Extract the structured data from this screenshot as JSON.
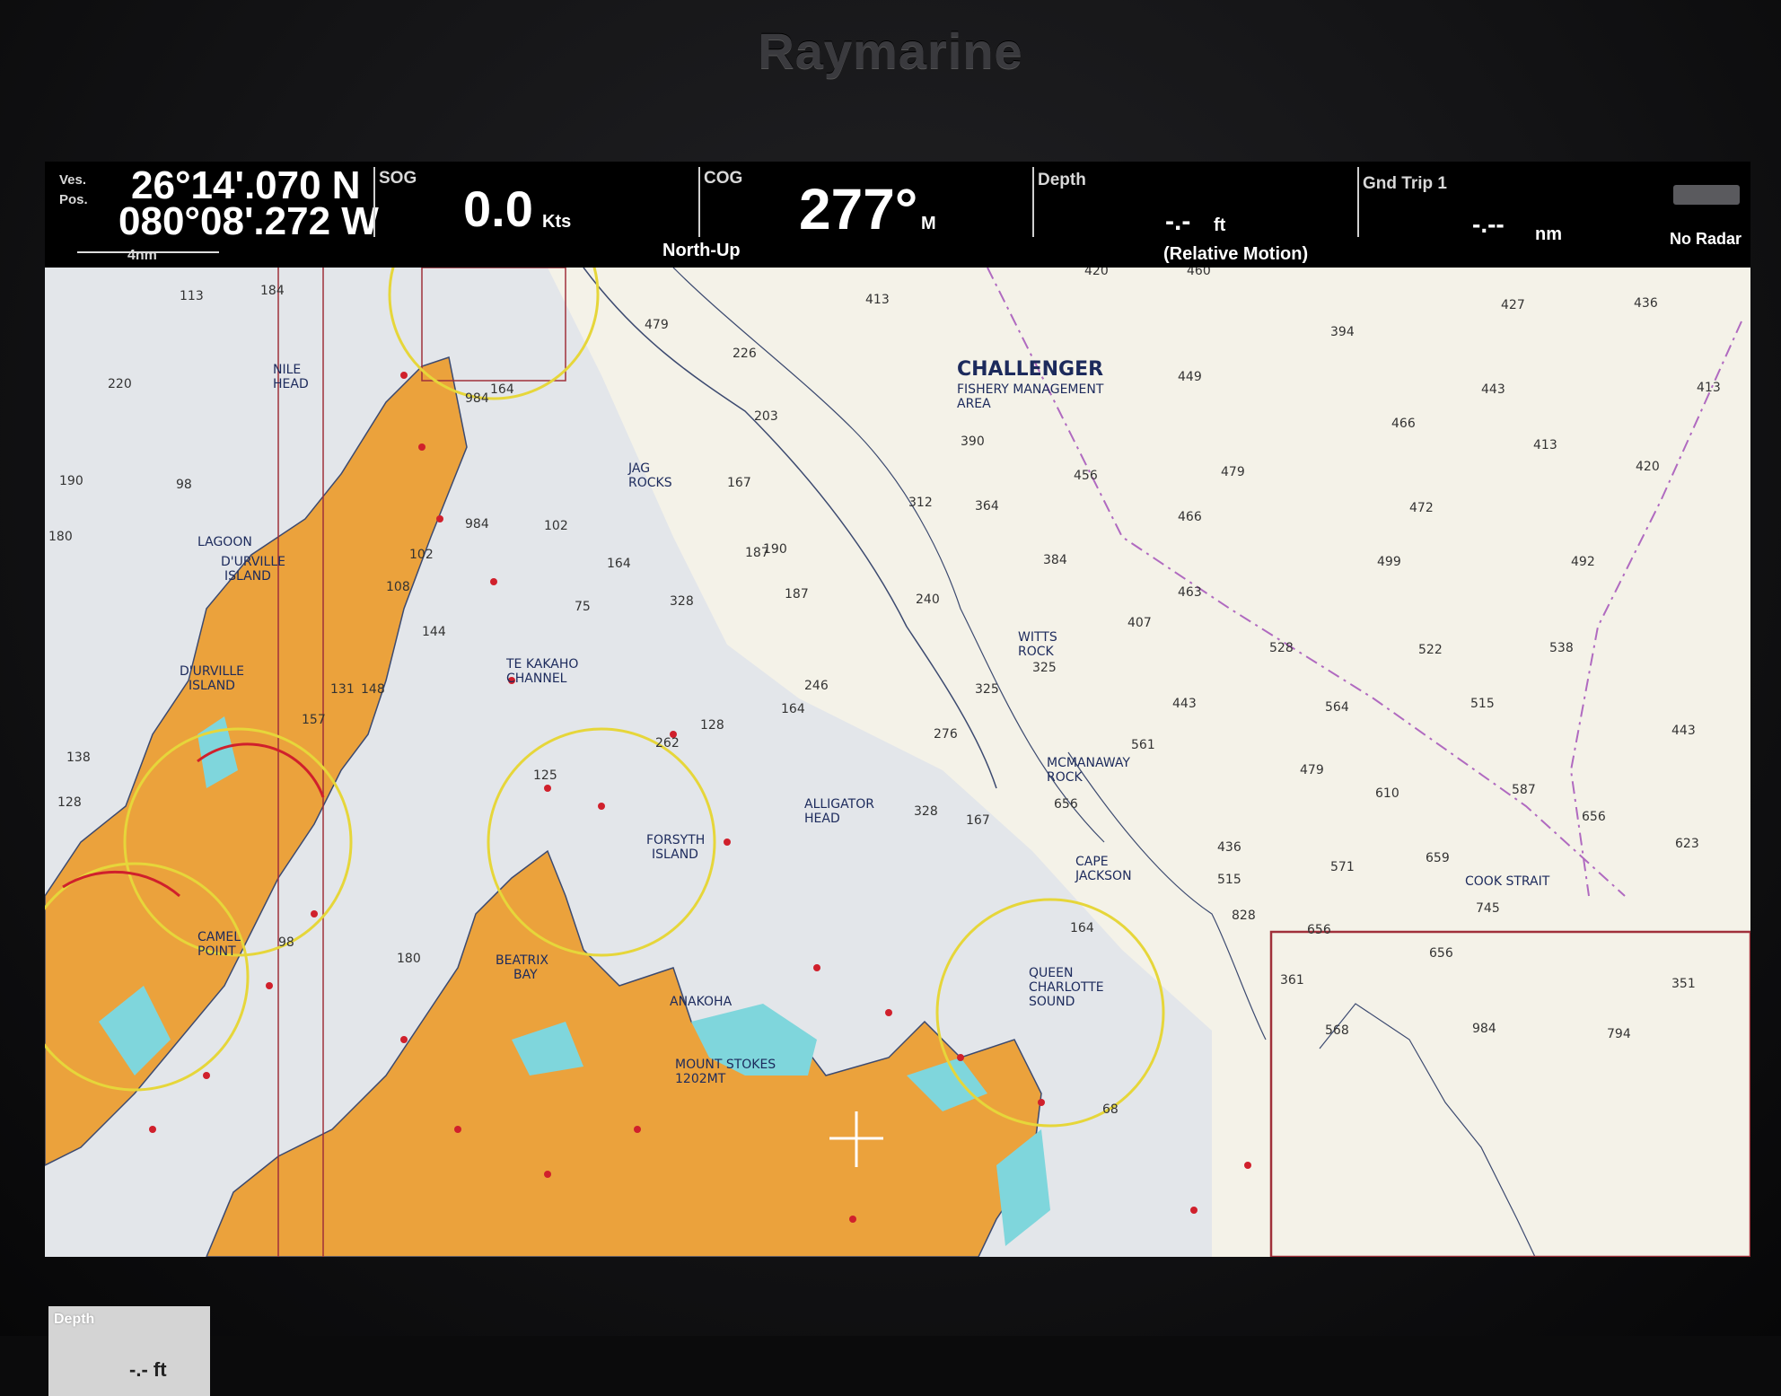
{
  "device": {
    "brand": "Raymarine"
  },
  "databar": {
    "position": {
      "label_line1": "Ves.",
      "label_line2": "Pos.",
      "lat": "26°14'.070 N",
      "lon": "080°08'.272 W",
      "scale": "4nm"
    },
    "sog": {
      "label": "SOG",
      "value": "0.0",
      "unit": "Kts"
    },
    "cog": {
      "label": "COG",
      "value": "277°",
      "unit": "M",
      "mode": "North-Up"
    },
    "depth": {
      "label": "Depth",
      "value": "-.-",
      "unit": "ft",
      "motion": "(Relative Motion)"
    },
    "trip": {
      "label": "Gnd Trip 1",
      "value": "-.--",
      "unit": "nm"
    },
    "radar": {
      "label": "No Radar"
    }
  },
  "chart": {
    "colors": {
      "land": "#eba23c",
      "shallow": "#7fd6dc",
      "water": "#f4f2e8",
      "contour": "#3c4a70",
      "boundary": "#b06ac0",
      "circle": "#e6d63a",
      "light": "#d0202c"
    },
    "place_names": [
      "CHALLENGER",
      "FISHERY MANAGEMENT",
      "AREA",
      "NILE",
      "HEAD",
      "JAG",
      "ROCKS",
      "LAGOON",
      "D'URVILLE",
      "ISLAND",
      "D'URVILLE",
      "ISLAND",
      "TE KAKAHO",
      "CHANNEL",
      "WITTS",
      "ROCK",
      "MCMANAWAY",
      "ROCK",
      "ALLIGATOR",
      "HEAD",
      "FORSYTH",
      "ISLAND",
      "CAPE",
      "JACKSON",
      "QUEEN",
      "CHARLOTTE",
      "SOUND",
      "CAMEL",
      "POINT",
      "BEATRIX",
      "BAY",
      "ANAKOHA",
      "MOUNT STOKES",
      "1202MT",
      "COOK STRAIT"
    ],
    "soundings": [
      "184",
      "113",
      "220",
      "190",
      "180",
      "98",
      "102",
      "102",
      "108",
      "144",
      "131",
      "148",
      "157",
      "138",
      "128",
      "984",
      "164",
      "984",
      "75",
      "328",
      "187",
      "190",
      "164",
      "187",
      "226",
      "203",
      "167",
      "479",
      "413",
      "420",
      "460",
      "390",
      "312",
      "364",
      "456",
      "384",
      "240",
      "449",
      "479",
      "466",
      "463",
      "407",
      "394",
      "427",
      "436",
      "443",
      "466",
      "413",
      "413",
      "420",
      "472",
      "499",
      "492",
      "528",
      "522",
      "538",
      "325",
      "325",
      "246",
      "164",
      "128",
      "262",
      "125",
      "276",
      "443",
      "564",
      "515",
      "443",
      "561",
      "479",
      "610",
      "587",
      "656",
      "167",
      "656",
      "436",
      "515",
      "828",
      "164",
      "328",
      "98",
      "180",
      "68",
      "571",
      "659",
      "623",
      "745",
      "656",
      "656",
      "361",
      "351",
      "568",
      "984",
      "794"
    ]
  },
  "depth_inset": {
    "label": "Depth",
    "value": "-.- ft"
  }
}
